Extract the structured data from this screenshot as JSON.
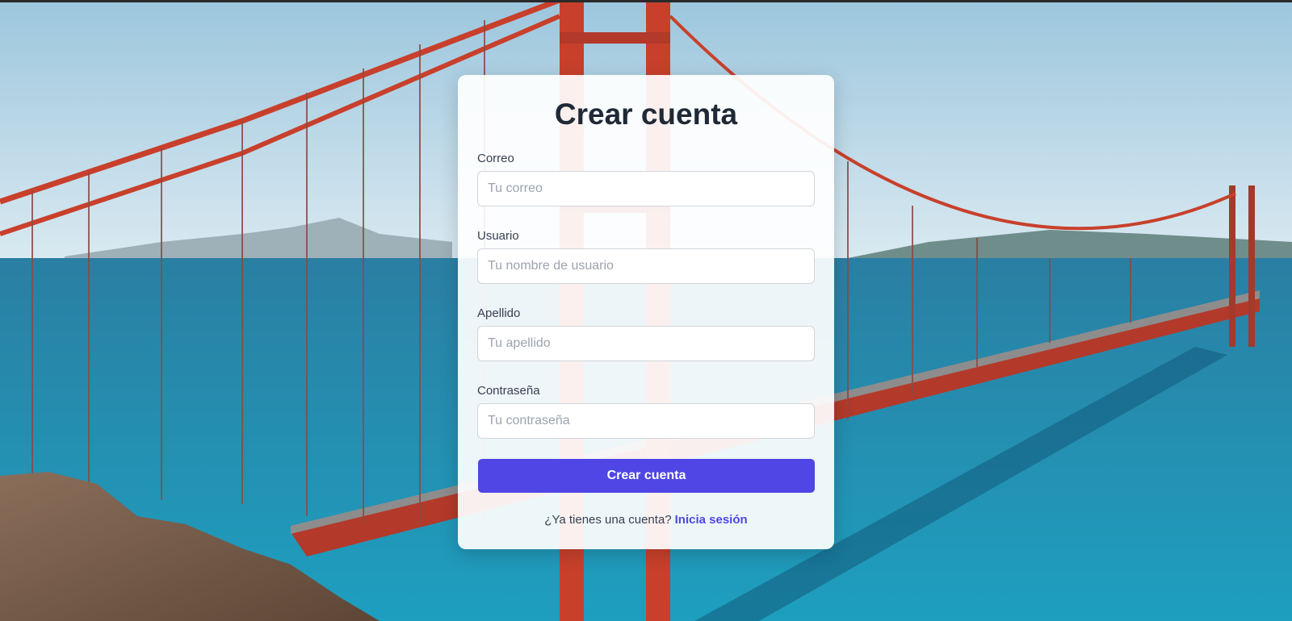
{
  "form": {
    "title": "Crear cuenta",
    "fields": [
      {
        "label": "Correo",
        "placeholder": "Tu correo",
        "value": ""
      },
      {
        "label": "Usuario",
        "placeholder": "Tu nombre de usuario",
        "value": ""
      },
      {
        "label": "Apellido",
        "placeholder": "Tu apellido",
        "value": ""
      },
      {
        "label": "Contraseña",
        "placeholder": "Tu contraseña",
        "value": ""
      }
    ],
    "submit_label": "Crear cuenta",
    "login_prompt": "¿Ya tienes una cuenta?",
    "login_link": "Inicia sesión"
  },
  "colors": {
    "accent": "#4f46e5",
    "title": "#1f2937",
    "sky": "#bcd9e8",
    "sea": "#1d8fb4",
    "bridge": "#c8402c"
  }
}
